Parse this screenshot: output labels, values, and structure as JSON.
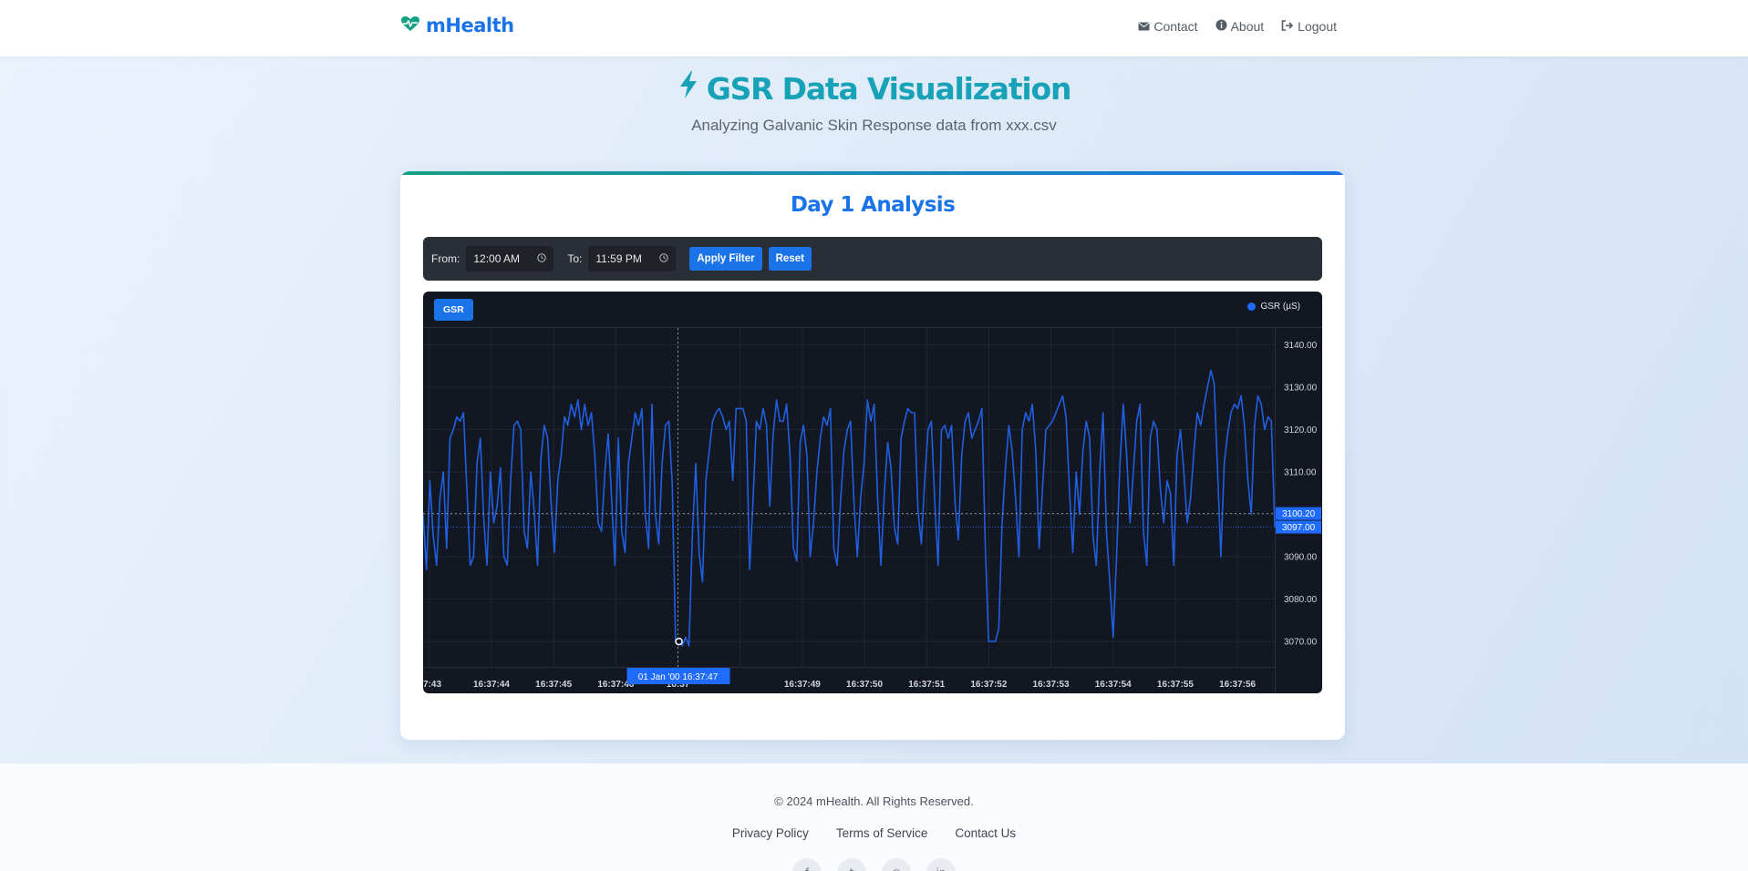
{
  "nav": {
    "brand": "mHealth",
    "links": [
      {
        "label": "Contact",
        "icon": "envelope-icon"
      },
      {
        "label": "About",
        "icon": "info-circle-icon"
      },
      {
        "label": "Logout",
        "icon": "sign-out-icon"
      }
    ]
  },
  "header": {
    "title": "GSR Data Visualization",
    "subtitle": "Analyzing Galvanic Skin Response data from xxx.csv"
  },
  "card": {
    "title": "Day 1 Analysis",
    "filter": {
      "from_label": "From:",
      "from_value": "12:00 AM",
      "to_label": "To:",
      "to_value": "11:59 PM",
      "apply_label": "Apply Filter",
      "reset_label": "Reset"
    },
    "series_button": "GSR"
  },
  "colors": {
    "accent": "#1a73e8",
    "title_teal": "#17a2b8",
    "chart_bg": "#131722",
    "line": "#1f5fe0"
  },
  "chart_data": {
    "type": "line",
    "legend": [
      "GSR (µS)"
    ],
    "legend_position": "top-right",
    "y_ticks": [
      "3140.00",
      "3130.00",
      "3120.00",
      "3110.00",
      "3100.00",
      "3090.00",
      "3080.00",
      "3070.00"
    ],
    "ylim": [
      3064,
      3144
    ],
    "x_ticks": [
      "16:37:43",
      "16:37:44",
      "16:37:45",
      "16:37:46",
      "16:37:47",
      "16:37:48",
      "16:37:49",
      "16:37:50",
      "16:37:51",
      "16:37:52",
      "16:37:53",
      "16:37:54",
      "16:37:55",
      "16:37:56"
    ],
    "x_tick_labels_visible": [
      "7:43",
      "16:37:44",
      "16:37:45",
      "16:37:46",
      "16:37",
      "",
      "16:37:49",
      "16:37:50",
      "16:37:51",
      "16:37:52",
      "16:37:53",
      "16:37:54",
      "16:37:55",
      "16:37:56"
    ],
    "crosshair": {
      "date_label": "01 Jan '00",
      "time_label": "16:37:47",
      "hline_value": 3100.2
    },
    "last_value_label": "3097.00",
    "crosshair_value_label": "3100.20",
    "grid": true,
    "series": [
      {
        "name": "GSR (µS)",
        "x_start": "16:37:42.9",
        "x_end": "16:37:56.6",
        "values": [
          3100,
          3087,
          3108,
          3095,
          3088,
          3104,
          3110,
          3092,
          3118,
          3120,
          3123,
          3122,
          3124,
          3106,
          3088,
          3090,
          3112,
          3118,
          3099,
          3088,
          3110,
          3098,
          3102,
          3111,
          3090,
          3088,
          3108,
          3121,
          3122,
          3120,
          3096,
          3092,
          3110,
          3101,
          3088,
          3113,
          3121,
          3118,
          3103,
          3091,
          3108,
          3114,
          3123,
          3121,
          3126,
          3123,
          3127,
          3120,
          3126,
          3121,
          3124,
          3114,
          3098,
          3096,
          3110,
          3119,
          3104,
          3088,
          3118,
          3096,
          3091,
          3112,
          3118,
          3124,
          3121,
          3125,
          3100,
          3092,
          3126,
          3100,
          3093,
          3112,
          3121,
          3122,
          3107,
          3070,
          3070,
          3069,
          3071,
          3069,
          3095,
          3112,
          3091,
          3084,
          3108,
          3115,
          3122,
          3124,
          3125,
          3123,
          3120,
          3122,
          3108,
          3125,
          3125,
          3125,
          3122,
          3087,
          3103,
          3122,
          3120,
          3125,
          3121,
          3102,
          3119,
          3127,
          3122,
          3122,
          3126,
          3114,
          3092,
          3089,
          3117,
          3121,
          3114,
          3090,
          3098,
          3110,
          3118,
          3123,
          3121,
          3125,
          3092,
          3088,
          3103,
          3115,
          3120,
          3122,
          3103,
          3090,
          3104,
          3112,
          3127,
          3122,
          3126,
          3104,
          3088,
          3105,
          3117,
          3111,
          3097,
          3093,
          3118,
          3122,
          3125,
          3124,
          3124,
          3101,
          3093,
          3108,
          3120,
          3122,
          3103,
          3088,
          3120,
          3121,
          3118,
          3121,
          3103,
          3094,
          3114,
          3122,
          3124,
          3118,
          3120,
          3122,
          3125,
          3093,
          3070,
          3070,
          3070,
          3073,
          3098,
          3111,
          3121,
          3115,
          3104,
          3090,
          3120,
          3124,
          3122,
          3126,
          3115,
          3092,
          3106,
          3120,
          3121,
          3122,
          3124,
          3126,
          3128,
          3123,
          3106,
          3091,
          3110,
          3100,
          3115,
          3122,
          3118,
          3095,
          3088,
          3110,
          3124,
          3096,
          3084,
          3071,
          3090,
          3112,
          3126,
          3114,
          3098,
          3110,
          3122,
          3126,
          3096,
          3088,
          3118,
          3122,
          3120,
          3106,
          3098,
          3108,
          3105,
          3088,
          3114,
          3120,
          3110,
          3098,
          3104,
          3115,
          3124,
          3121,
          3126,
          3130,
          3134,
          3131,
          3111,
          3090,
          3112,
          3119,
          3124,
          3126,
          3125,
          3128,
          3121,
          3108,
          3100,
          3121,
          3128,
          3126,
          3120,
          3123,
          3122,
          3097
        ]
      }
    ]
  },
  "footer": {
    "copyright": "© 2024 mHealth. All Rights Reserved.",
    "links": [
      "Privacy Policy",
      "Terms of Service",
      "Contact Us"
    ],
    "socials": [
      "facebook-icon",
      "twitter-icon",
      "instagram-icon",
      "linkedin-icon"
    ]
  }
}
